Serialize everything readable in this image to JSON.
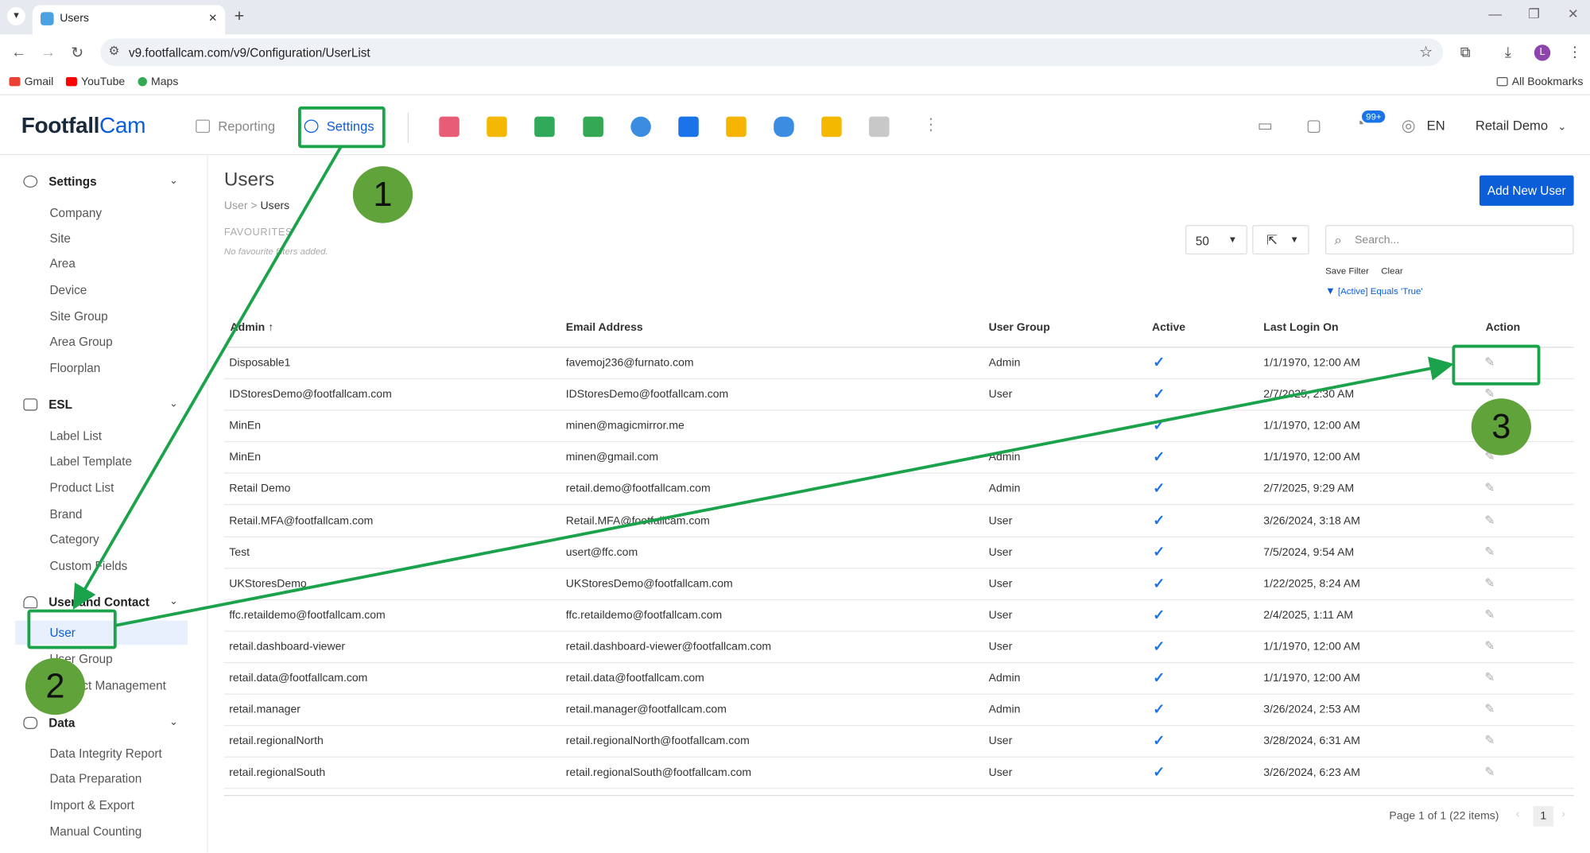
{
  "browser": {
    "tab_title": "Users",
    "url": "v9.footfallcam.com/v9/Configuration/UserList",
    "avatar_letter": "L",
    "bookmarks": [
      "Gmail",
      "YouTube",
      "Maps"
    ],
    "all_bookmarks": "All Bookmarks"
  },
  "header": {
    "logo_main": "Footfall",
    "logo_accent": "Cam",
    "nav_reporting": "Reporting",
    "nav_settings": "Settings",
    "notification_badge": "99+",
    "language": "EN",
    "user_name": "Retail Demo"
  },
  "sidebar": {
    "sections": [
      {
        "label": "Settings",
        "icon": "gear-icon",
        "items": [
          "Company",
          "Site",
          "Area",
          "Device",
          "Site Group",
          "Area Group",
          "Floorplan"
        ]
      },
      {
        "label": "ESL",
        "icon": "screen-icon",
        "items": [
          "Label List",
          "Label Template",
          "Product List",
          "Brand",
          "Category",
          "Custom Fields"
        ]
      },
      {
        "label": "User and Contact",
        "icon": "users-icon",
        "items": [
          "User",
          "User Group",
          "Contact Management"
        ]
      },
      {
        "label": "Data",
        "icon": "database-icon",
        "items": [
          "Data Integrity Report",
          "Data Preparation",
          "Import & Export",
          "Manual Counting"
        ]
      }
    ],
    "active_item": "User"
  },
  "page": {
    "title": "Users",
    "breadcrumb_root": "User",
    "breadcrumb_sep": ">",
    "breadcrumb_current": "Users",
    "favourites_heading": "FAVOURITES",
    "favourites_empty": "No favourite filters added.",
    "add_button": "Add New User",
    "page_size": "50",
    "search_placeholder": "Search...",
    "save_filter": "Save Filter",
    "clear": "Clear",
    "active_filter": "[Active] Equals 'True'"
  },
  "table": {
    "columns": [
      "Admin",
      "Email Address",
      "User Group",
      "Active",
      "Last Login On",
      "Action"
    ],
    "sort_indicator": "↑",
    "rows": [
      {
        "name": "Disposable1",
        "email": "favemoj236@furnato.com",
        "group": "Admin",
        "active": true,
        "last_login": "1/1/1970, 12:00 AM"
      },
      {
        "name": "IDStoresDemo@footfallcam.com",
        "email": "IDStoresDemo@footfallcam.com",
        "group": "User",
        "active": true,
        "last_login": "2/7/2025, 2:30 AM"
      },
      {
        "name": "MinEn",
        "email": "minen@magicmirror.me",
        "group": "",
        "active": true,
        "last_login": "1/1/1970, 12:00 AM"
      },
      {
        "name": "MinEn",
        "email": "minen@gmail.com",
        "group": "Admin",
        "active": true,
        "last_login": "1/1/1970, 12:00 AM"
      },
      {
        "name": "Retail Demo",
        "email": "retail.demo@footfallcam.com",
        "group": "Admin",
        "active": true,
        "last_login": "2/7/2025, 9:29 AM"
      },
      {
        "name": "Retail.MFA@footfallcam.com",
        "email": "Retail.MFA@footfallcam.com",
        "group": "User",
        "active": true,
        "last_login": "3/26/2024, 3:18 AM"
      },
      {
        "name": "Test",
        "email": "usert@ffc.com",
        "group": "User",
        "active": true,
        "last_login": "7/5/2024, 9:54 AM"
      },
      {
        "name": "UKStoresDemo",
        "email": "UKStoresDemo@footfallcam.com",
        "group": "User",
        "active": true,
        "last_login": "1/22/2025, 8:24 AM"
      },
      {
        "name": "ffc.retaildemo@footfallcam.com",
        "email": "ffc.retaildemo@footfallcam.com",
        "group": "User",
        "active": true,
        "last_login": "2/4/2025, 1:11 AM"
      },
      {
        "name": "retail.dashboard-viewer",
        "email": "retail.dashboard-viewer@footfallcam.com",
        "group": "User",
        "active": true,
        "last_login": "1/1/1970, 12:00 AM"
      },
      {
        "name": "retail.data@footfallcam.com",
        "email": "retail.data@footfallcam.com",
        "group": "Admin",
        "active": true,
        "last_login": "1/1/1970, 12:00 AM"
      },
      {
        "name": "retail.manager",
        "email": "retail.manager@footfallcam.com",
        "group": "Admin",
        "active": true,
        "last_login": "3/26/2024, 2:53 AM"
      },
      {
        "name": "retail.regionalNorth",
        "email": "retail.regionalNorth@footfallcam.com",
        "group": "User",
        "active": true,
        "last_login": "3/28/2024, 6:31 AM"
      },
      {
        "name": "retail.regionalSouth",
        "email": "retail.regionalSouth@footfallcam.com",
        "group": "User",
        "active": true,
        "last_login": "3/26/2024, 6:23 AM"
      }
    ],
    "pagination": "Page 1 of 1 (22 items)",
    "current_page": "1"
  },
  "annotations": {
    "step1": "1",
    "step2": "2",
    "step3": "3",
    "color": "#1aa34a",
    "badge_color": "#5fa33a"
  },
  "colors": {
    "accent": "#0b5ed7",
    "check": "#1a73e8"
  }
}
